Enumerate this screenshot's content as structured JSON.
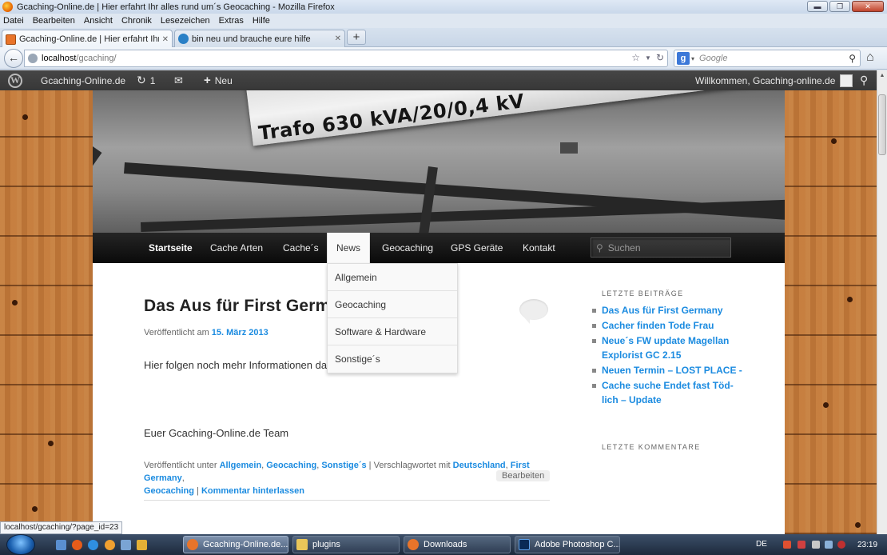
{
  "window": {
    "title": "Gcaching-Online.de | Hier erfahrt Ihr alles rund um´s Geocaching - Mozilla Firefox",
    "buttons": [
      "▬",
      "❐",
      "✕"
    ]
  },
  "menubar": [
    "Datei",
    "Bearbeiten",
    "Ansicht",
    "Chronik",
    "Lesezeichen",
    "Extras",
    "Hilfe"
  ],
  "tabs": [
    {
      "label": "Gcaching-Online.de | Hier erfahrt Ihr ...",
      "close": "✕"
    },
    {
      "label": "bin neu und brauche eure hilfe",
      "close": "✕"
    }
  ],
  "newtab_label": "+",
  "navbar": {
    "back": "←",
    "url_host": "localhost",
    "url_path": "/gcaching/",
    "bookmark_star": "☆",
    "dropmarker": "▼",
    "reload": "↻",
    "search_engine": "g",
    "search_dropmarker": "▾",
    "search_placeholder": "Google",
    "search_icon": "⚲",
    "home_icon": "⌂"
  },
  "adminbar": {
    "logo": "W",
    "site_name": "Gcaching-Online.de",
    "updates_icon": "↻",
    "updates_count": "1",
    "comments_icon": "✉",
    "new_icon": "+",
    "new_label": "Neu",
    "greeting": "Willkommen, Gcaching-online.de",
    "search_icon": "⚲"
  },
  "header_image_text": "Trafo 630 kVA/20/0,4 kV",
  "nav": {
    "items": [
      "Startseite",
      "Cache Arten",
      "Cache´s",
      "News",
      "Geocaching",
      "GPS Geräte",
      "Kontakt"
    ],
    "search_placeholder": "Suchen",
    "search_icon": "⚲"
  },
  "dropdown": [
    "Allgemein",
    "Geocaching",
    "Software & Hardware",
    "Sonstige´s"
  ],
  "post": {
    "title": "Das Aus für First Germany",
    "date_prefix": "Veröffentlicht am ",
    "date": "15. März 2013",
    "body1": "Hier folgen noch mehr Informationen dazu",
    "body2": "Euer Gcaching-Online.de Team",
    "footer": {
      "published_in": "Veröffentlicht unter ",
      "cat1": "Allgemein",
      "cat2": "Geocaching",
      "cat3": "Sonstige´s",
      "tagged": " | Verschlagwortet mit ",
      "tag1": "Deutschland",
      "tag2": "First Germany",
      "tag3": "Geocaching",
      "sep": " | ",
      "comment_link": "Kommentar hinterlassen",
      "edit": "Bearbeiten"
    }
  },
  "sidebar": {
    "recent_title": "LETZTE BEITRÄGE",
    "recent": [
      "Das Aus für First Germany",
      "Cacher finden Tode Frau",
      "Neue´s FW update Magellan Explorist GC 2.15",
      "Neuen Termin – LOST PLACE -",
      "Cache suche Endet fast Töd-lich – Update"
    ],
    "comments_title": "LETZTE KOMMENTARE"
  },
  "statusbar": "localhost/gcaching/?page_id=23",
  "taskbar": {
    "tasks": [
      "Gcaching-Online.de...",
      "plugins",
      "Downloads",
      "Adobe Photoshop C..."
    ],
    "language": "DE",
    "clock": "23:19"
  },
  "colors": {
    "link": "#1b8be0",
    "wood": "#c27a3b",
    "adminbar": "#3d3d3d",
    "nav": "#111111"
  }
}
